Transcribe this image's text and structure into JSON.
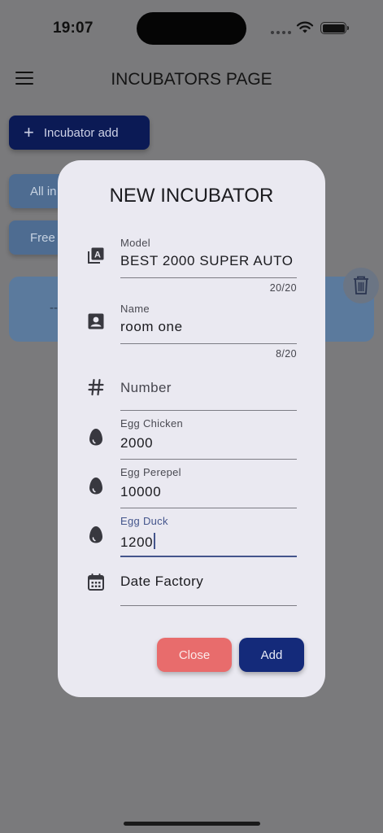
{
  "status_bar": {
    "time": "19:07"
  },
  "app_bar": {
    "title": "INCUBATORS PAGE",
    "menu_icon": "hamburger-menu-icon"
  },
  "background": {
    "add_button_label": "Incubator add",
    "filter_all_label": "All in",
    "filter_free_label": "Free",
    "card_text": "--"
  },
  "dialog": {
    "title": "NEW INCUBATOR",
    "fields": {
      "model": {
        "label": "Model",
        "value": "BEST 2000 SUPER AUTO",
        "counter": "20/20",
        "icon": "model-badge-icon"
      },
      "name": {
        "label": "Name",
        "value": "room one",
        "counter": "8/20",
        "icon": "contact-card-icon"
      },
      "number": {
        "placeholder": "Number",
        "icon": "hash-icon"
      },
      "egg_chicken": {
        "label": "Egg Chicken",
        "value": "2000",
        "icon": "egg-icon"
      },
      "egg_perepel": {
        "label": "Egg Perepel",
        "value": "10000",
        "icon": "egg-icon"
      },
      "egg_duck": {
        "label": "Egg Duck",
        "value": "1200",
        "icon": "egg-icon"
      },
      "date_factory": {
        "placeholder": "Date Factory",
        "icon": "calendar-icon"
      }
    },
    "close_label": "Close",
    "add_label": "Add"
  },
  "colors": {
    "accent": "#142a7a",
    "danger": "#e86c6c",
    "dialog_bg": "#eae9f1",
    "focus": "#44558c"
  }
}
